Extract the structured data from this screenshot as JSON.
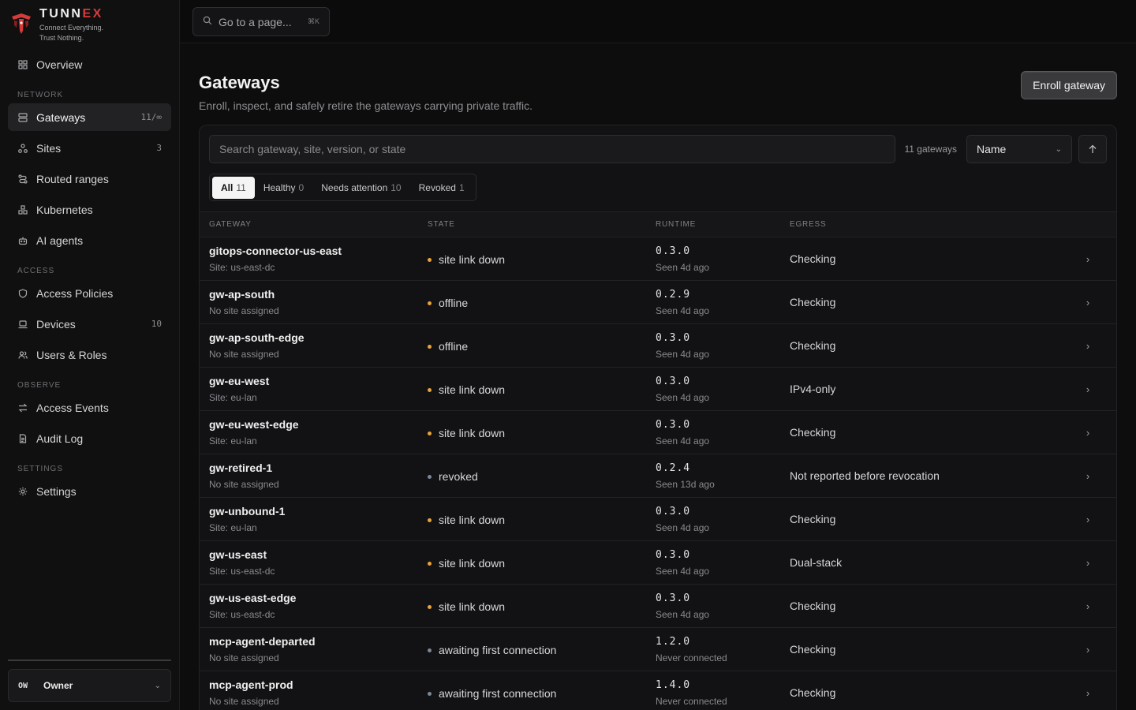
{
  "brand": {
    "name_main": "TUNN",
    "name_accent": "EX",
    "tagline_1": "Connect Everything.",
    "tagline_2": "Trust Nothing."
  },
  "sidebar": {
    "overview": {
      "label": "Overview",
      "icon": "grid-icon"
    },
    "sections": {
      "network": "NETWORK",
      "access": "ACCESS",
      "observe": "OBSERVE",
      "settings": "SETTINGS"
    },
    "items": {
      "gateways": {
        "label": "Gateways",
        "count": "11/∞",
        "icon": "server-icon"
      },
      "sites": {
        "label": "Sites",
        "count": "3",
        "icon": "sites-icon"
      },
      "routed_ranges": {
        "label": "Routed ranges",
        "count": "",
        "icon": "route-icon"
      },
      "kubernetes": {
        "label": "Kubernetes",
        "count": "",
        "icon": "cluster-icon"
      },
      "ai_agents": {
        "label": "AI agents",
        "count": "",
        "icon": "bot-icon"
      },
      "access_policies": {
        "label": "Access Policies",
        "count": "",
        "icon": "shield-icon"
      },
      "devices": {
        "label": "Devices",
        "count": "10",
        "icon": "laptop-icon"
      },
      "users_roles": {
        "label": "Users & Roles",
        "count": "",
        "icon": "users-icon"
      },
      "access_events": {
        "label": "Access Events",
        "count": "",
        "icon": "arrows-icon"
      },
      "audit_log": {
        "label": "Audit Log",
        "count": "",
        "icon": "document-icon"
      },
      "settings": {
        "label": "Settings",
        "count": "",
        "icon": "gear-icon"
      }
    },
    "owner": {
      "initials": "OW",
      "name": "Owner"
    }
  },
  "topbar": {
    "command_placeholder": "Go to a page...",
    "shortcut": "⌘K"
  },
  "page": {
    "title": "Gateways",
    "subtitle": "Enroll, inspect, and safely retire the gateways carrying private traffic.",
    "enroll_label": "Enroll gateway"
  },
  "toolbar": {
    "search_placeholder": "Search gateway, site, version, or state",
    "count_label": "11 gateways",
    "sort_value": "Name"
  },
  "filters": [
    {
      "label": "All",
      "count": "11"
    },
    {
      "label": "Healthy",
      "count": "0"
    },
    {
      "label": "Needs attention",
      "count": "10"
    },
    {
      "label": "Revoked",
      "count": "1"
    }
  ],
  "columns": {
    "gateway": "GATEWAY",
    "state": "STATE",
    "runtime": "RUNTIME",
    "egress": "EGRESS"
  },
  "colors": {
    "warning": "#e8a33c",
    "neutral": "#7d8796",
    "accent": "#d63b3b"
  },
  "gateways": [
    {
      "name": "gitops-connector-us-east",
      "site": "Site: us-east-dc",
      "state": "site link down",
      "state_color": "#e8a33c",
      "version": "0.3.0",
      "seen": "Seen 4d ago",
      "egress": "Checking"
    },
    {
      "name": "gw-ap-south",
      "site": "No site assigned",
      "state": "offline",
      "state_color": "#e8a33c",
      "version": "0.2.9",
      "seen": "Seen 4d ago",
      "egress": "Checking"
    },
    {
      "name": "gw-ap-south-edge",
      "site": "No site assigned",
      "state": "offline",
      "state_color": "#e8a33c",
      "version": "0.3.0",
      "seen": "Seen 4d ago",
      "egress": "Checking"
    },
    {
      "name": "gw-eu-west",
      "site": "Site: eu-lan",
      "state": "site link down",
      "state_color": "#e8a33c",
      "version": "0.3.0",
      "seen": "Seen 4d ago",
      "egress": "IPv4-only"
    },
    {
      "name": "gw-eu-west-edge",
      "site": "Site: eu-lan",
      "state": "site link down",
      "state_color": "#e8a33c",
      "version": "0.3.0",
      "seen": "Seen 4d ago",
      "egress": "Checking"
    },
    {
      "name": "gw-retired-1",
      "site": "No site assigned",
      "state": "revoked",
      "state_color": "#7d8796",
      "version": "0.2.4",
      "seen": "Seen 13d ago",
      "egress": "Not reported before revocation"
    },
    {
      "name": "gw-unbound-1",
      "site": "Site: eu-lan",
      "state": "site link down",
      "state_color": "#e8a33c",
      "version": "0.3.0",
      "seen": "Seen 4d ago",
      "egress": "Checking"
    },
    {
      "name": "gw-us-east",
      "site": "Site: us-east-dc",
      "state": "site link down",
      "state_color": "#e8a33c",
      "version": "0.3.0",
      "seen": "Seen 4d ago",
      "egress": "Dual-stack"
    },
    {
      "name": "gw-us-east-edge",
      "site": "Site: us-east-dc",
      "state": "site link down",
      "state_color": "#e8a33c",
      "version": "0.3.0",
      "seen": "Seen 4d ago",
      "egress": "Checking"
    },
    {
      "name": "mcp-agent-departed",
      "site": "No site assigned",
      "state": "awaiting first connection",
      "state_color": "#7d8796",
      "version": "1.2.0",
      "seen": "Never connected",
      "egress": "Checking"
    },
    {
      "name": "mcp-agent-prod",
      "site": "No site assigned",
      "state": "awaiting first connection",
      "state_color": "#7d8796",
      "version": "1.4.0",
      "seen": "Never connected",
      "egress": "Checking"
    }
  ]
}
